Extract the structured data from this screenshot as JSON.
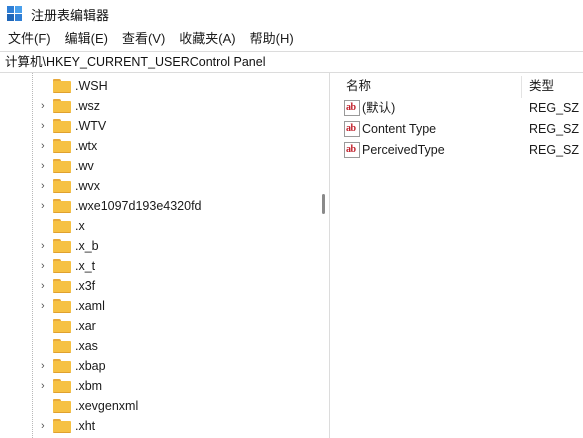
{
  "window": {
    "title": "注册表编辑器",
    "icon": "registry-icon"
  },
  "menu": [
    "文件(F)",
    "编辑(E)",
    "查看(V)",
    "收藏夹(A)",
    "帮助(H)"
  ],
  "address": "计算机\\HKEY_CURRENT_USERControl Panel",
  "tree": {
    "items": [
      {
        "label": ".WSH",
        "expandable": false
      },
      {
        "label": ".wsz",
        "expandable": true
      },
      {
        "label": ".WTV",
        "expandable": true
      },
      {
        "label": ".wtx",
        "expandable": true
      },
      {
        "label": ".wv",
        "expandable": true
      },
      {
        "label": ".wvx",
        "expandable": true
      },
      {
        "label": ".wxe1097d193e4320fd",
        "expandable": true
      },
      {
        "label": ".x",
        "expandable": false
      },
      {
        "label": ".x_b",
        "expandable": true
      },
      {
        "label": ".x_t",
        "expandable": true
      },
      {
        "label": ".x3f",
        "expandable": true
      },
      {
        "label": ".xaml",
        "expandable": true
      },
      {
        "label": ".xar",
        "expandable": false
      },
      {
        "label": ".xas",
        "expandable": false
      },
      {
        "label": ".xbap",
        "expandable": true
      },
      {
        "label": ".xbm",
        "expandable": true
      },
      {
        "label": ".xevgenxml",
        "expandable": false
      },
      {
        "label": ".xht",
        "expandable": true
      }
    ]
  },
  "list": {
    "columns": {
      "name": "名称",
      "type": "类型"
    },
    "rows": [
      {
        "name": "(默认)",
        "type": "REG_SZ",
        "icon": "ab-string-icon"
      },
      {
        "name": "Content Type",
        "type": "REG_SZ",
        "icon": "ab-string-icon"
      },
      {
        "name": "PerceivedType",
        "type": "REG_SZ",
        "icon": "ab-string-icon"
      }
    ],
    "icon_glyph": "ab"
  },
  "colors": {
    "folder": "#f6c143",
    "folder_tab": "#e8a93a",
    "string_icon": "#c0202b",
    "divider": "#dcdcdc"
  }
}
